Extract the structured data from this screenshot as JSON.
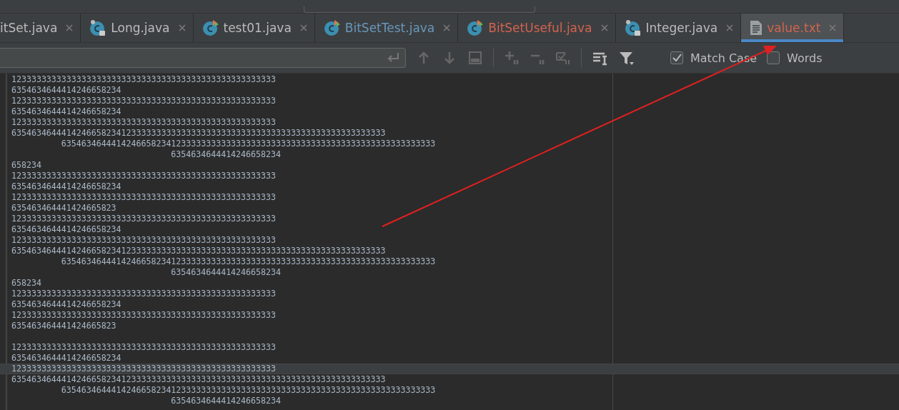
{
  "tabs": [
    {
      "label": "itSet.java",
      "color": "#bbbbbb",
      "selected": false
    },
    {
      "label": "Long.java",
      "kind": "locked",
      "color": "#bbbbbb",
      "selected": false
    },
    {
      "label": "test01.java",
      "kind": "runnable",
      "color": "#bbbbbb",
      "selected": false
    },
    {
      "label": "BitSetTest.java",
      "kind": "runnable",
      "color": "#6897bb",
      "selected": false
    },
    {
      "label": "BitSetUseful.java",
      "kind": "runnable",
      "color": "#d2634f",
      "selected": false
    },
    {
      "label": "Integer.java",
      "kind": "locked",
      "color": "#bbbbbb",
      "selected": false
    },
    {
      "label": "value.txt",
      "kind": "text",
      "color": "#d2634f",
      "selected": true
    }
  ],
  "find_bar": {
    "match_case": {
      "label": "Match Case",
      "checked": true
    },
    "words": {
      "label": "Words",
      "checked": false
    }
  },
  "editor": {
    "lines": [
      {
        "kind": "text",
        "text": "12333333333333333333333333333333333333333333333333333",
        "current": false
      },
      {
        "kind": "text",
        "text": "6354634644414246658234",
        "current": false
      },
      {
        "kind": "text",
        "text": "12333333333333333333333333333333333333333333333333333",
        "current": false
      },
      {
        "kind": "text",
        "text": "6354634644414246658234",
        "current": false
      },
      {
        "kind": "text",
        "text": "12333333333333333333333333333333333333333333333333333",
        "current": false
      },
      {
        "kind": "text",
        "text": "635463464441424665823412333333333333333333333333333333333333333333333333333",
        "current": false
      },
      {
        "kind": "text",
        "text": "          635463464441424665823412333333333333333333333333333333333333333333333333333",
        "current": false
      },
      {
        "kind": "text",
        "text": "                                6354634644414246658234",
        "current": false
      },
      {
        "kind": "text",
        "text": "658234",
        "current": false
      },
      {
        "kind": "text",
        "text": "12333333333333333333333333333333333333333333333333333",
        "current": false
      },
      {
        "kind": "text",
        "text": "6354634644414246658234",
        "current": false
      },
      {
        "kind": "text",
        "text": "12333333333333333333333333333333333333333333333333333",
        "current": false
      },
      {
        "kind": "text",
        "text": "635463464441424665823",
        "current": false
      },
      {
        "kind": "text",
        "text": "12333333333333333333333333333333333333333333333333333",
        "current": false
      },
      {
        "kind": "text",
        "text": "6354634644414246658234",
        "current": false
      },
      {
        "kind": "text",
        "text": "12333333333333333333333333333333333333333333333333333",
        "current": false
      },
      {
        "kind": "text",
        "text": "635463464441424665823412333333333333333333333333333333333333333333333333333",
        "current": false
      },
      {
        "kind": "text",
        "text": "          635463464441424665823412333333333333333333333333333333333333333333333333333",
        "current": false
      },
      {
        "kind": "text",
        "text": "                                6354634644414246658234",
        "current": false
      },
      {
        "kind": "text",
        "text": "658234",
        "current": false
      },
      {
        "kind": "text",
        "text": "12333333333333333333333333333333333333333333333333333",
        "current": false
      },
      {
        "kind": "text",
        "text": "6354634644414246658234",
        "current": false
      },
      {
        "kind": "text",
        "text": "12333333333333333333333333333333333333333333333333333",
        "current": false
      },
      {
        "kind": "text",
        "text": "635463464441424665823",
        "current": false
      },
      {
        "kind": "blank",
        "current": false
      },
      {
        "kind": "text",
        "text": "12333333333333333333333333333333333333333333333333333",
        "current": false
      },
      {
        "kind": "text",
        "text": "6354634644414246658234",
        "current": false
      },
      {
        "kind": "text",
        "text": "12333333333333333333333333333333333333333333333333333",
        "current": true
      },
      {
        "kind": "text",
        "text": "635463464441424665823412333333333333333333333333333333333333333333333333333",
        "current": false
      },
      {
        "kind": "text",
        "text": "          635463464441424665823412333333333333333333333333333333333333333333333333333",
        "current": false
      },
      {
        "kind": "text",
        "text": "                                6354634644414246658234",
        "current": false
      }
    ]
  }
}
